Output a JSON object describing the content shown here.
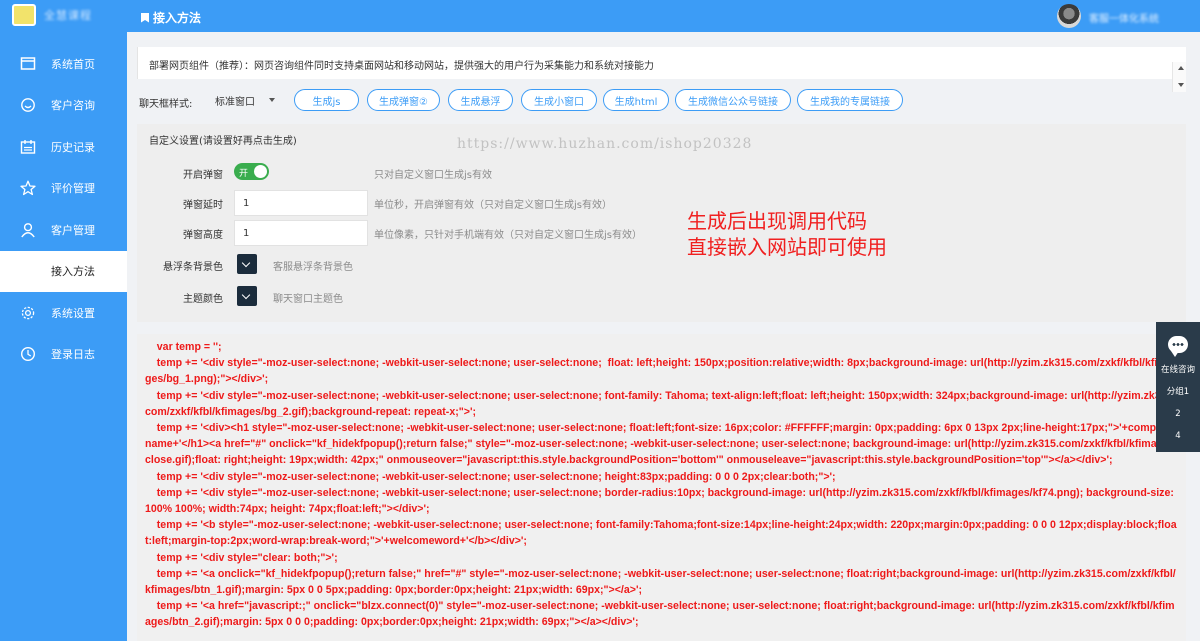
{
  "app": {
    "logo_text": "全慧课程",
    "username": "客服一体化系统"
  },
  "sidebar": {
    "items": [
      {
        "label": "系统首页",
        "icon": "window-icon"
      },
      {
        "label": "客户咨询",
        "icon": "chat-bubble-icon"
      },
      {
        "label": "历史记录",
        "icon": "calendar-icon"
      },
      {
        "label": "评价管理",
        "icon": "star-icon"
      },
      {
        "label": "客户管理",
        "icon": "user-icon"
      },
      {
        "label": "接入方法",
        "icon": "",
        "active": true
      },
      {
        "label": "系统设置",
        "icon": "gear-icon"
      },
      {
        "label": "登录日志",
        "icon": "clock-icon"
      }
    ]
  },
  "header": {
    "title": "接入方法"
  },
  "main": {
    "description": "部署网页组件（推荐）：网页咨询组件同时支持桌面网站和移动网站，提供强大的用户行为采集能力和系统对接能力",
    "style_label": "聊天框样式:",
    "style_select": "标准窗口",
    "buttons": [
      "生成js",
      "生成弹窗②",
      "生成悬浮",
      "生成小窗口",
      "生成html",
      "生成微信公众号链接",
      "生成我的专属链接"
    ],
    "panel_title": "自定义设置(请设置好再点击生成)",
    "watermark": "https://www.huzhan.com/ishop20328",
    "settings": {
      "popup": {
        "label": "开启弹窗",
        "toggle": "开",
        "hint": "只对自定义窗口生成js有效"
      },
      "delay": {
        "label": "弹窗延时",
        "value": "1",
        "hint": "单位秒，开启弹窗有效（只对自定义窗口生成js有效）"
      },
      "height": {
        "label": "弹窗高度",
        "value": "1",
        "hint": "单位像素，只针对手机端有效（只对自定义窗口生成js有效）"
      },
      "float_bg": {
        "label": "悬浮条背景色",
        "hint": "客服悬浮条背景色"
      },
      "theme": {
        "label": "主题颜色",
        "hint": "聊天窗口主题色"
      }
    },
    "annotation_line1": "生成后出现调用代码",
    "annotation_line2": "直接嵌入网站即可使用"
  },
  "code_lines": [
    "    var temp = '';",
    "    temp += '<div style=\"-moz-user-select:none; -webkit-user-select:none; user-select:none;  float: left;height: 150px;position:relative;width: 8px;background-image: url(http://yzim.zk315.com/zxkf/kfbl/kfimages/bg_1.png);\"></div>';",
    "    temp += '<div style=\"-moz-user-select:none; -webkit-user-select:none; user-select:none; font-family: Tahoma; text-align:left;float: left;height: 150px;width: 324px;background-image: url(http://yzim.zk315.com/zxkf/kfbl/kfimages/bg_2.gif);background-repeat: repeat-x;\">';",
    "    temp += '<div><h1 style=\"-moz-user-select:none; -webkit-user-select:none; user-select:none; float:left;font-size: 16px;color: #FFFFFF;margin: 0px;padding: 6px 0 13px 2px;line-height:17px;\">'+companyname+'</h1><a href=\"#\" onclick=\"kf_hidekfpopup();return false;\" style=\"-moz-user-select:none; -webkit-user-select:none; user-select:none; background-image: url(http://yzim.zk315.com/zxkf/kfbl/kfimages/close.gif);float: right;height: 19px;width: 42px;\" onmouseover=\"javascript:this.style.backgroundPosition='bottom'\" onmouseleave=\"javascript:this.style.backgroundPosition='top'\"></a></div>';",
    "    temp += '<div style=\"-moz-user-select:none; -webkit-user-select:none; user-select:none; height:83px;padding: 0 0 0 2px;clear:both;\">';",
    "    temp += '<div style=\"-moz-user-select:none; -webkit-user-select:none; user-select:none; border-radius:10px; background-image: url(http://yzim.zk315.com/zxkf/kfbl/kfimages/kf74.png); background-size:100% 100%; width:74px; height: 74px;float:left;\"></div>';",
    "    temp += '<b style=\"-moz-user-select:none; -webkit-user-select:none; user-select:none; font-family:Tahoma;font-size:14px;line-height:24px;width: 220px;margin:0px;padding: 0 0 0 12px;display:block;float:left;margin-top:2px;word-wrap:break-word;\">'+welcomeword+'</b></div>';",
    "    temp += '<div style=\"clear: both;\">';",
    "    temp += '<a onclick=\"kf_hidekfpopup();return false;\" href=\"#\" style=\"-moz-user-select:none; -webkit-user-select:none; user-select:none; float:right;background-image: url(http://yzim.zk315.com/zxkf/kfbl/kfimages/btn_1.gif);margin: 5px 0 0 5px;padding: 0px;border:0px;height: 21px;width: 69px;\"></a>';",
    "    temp += '<a href=\"javascript:;\" onclick=\"blzx.connect(0)\" style=\"-moz-user-select:none; -webkit-user-select:none; user-select:none; float:right;background-image: url(http://yzim.zk315.com/zxkf/kfbl/kfimages/btn_2.gif);margin: 5px 0 0 0;padding: 0px;border:0px;height: 21px;width: 69px;\"></a></div>';"
  ],
  "float_widget": {
    "label": "在线咨询",
    "group": "分组1",
    "num1": "2",
    "num2": "4"
  }
}
